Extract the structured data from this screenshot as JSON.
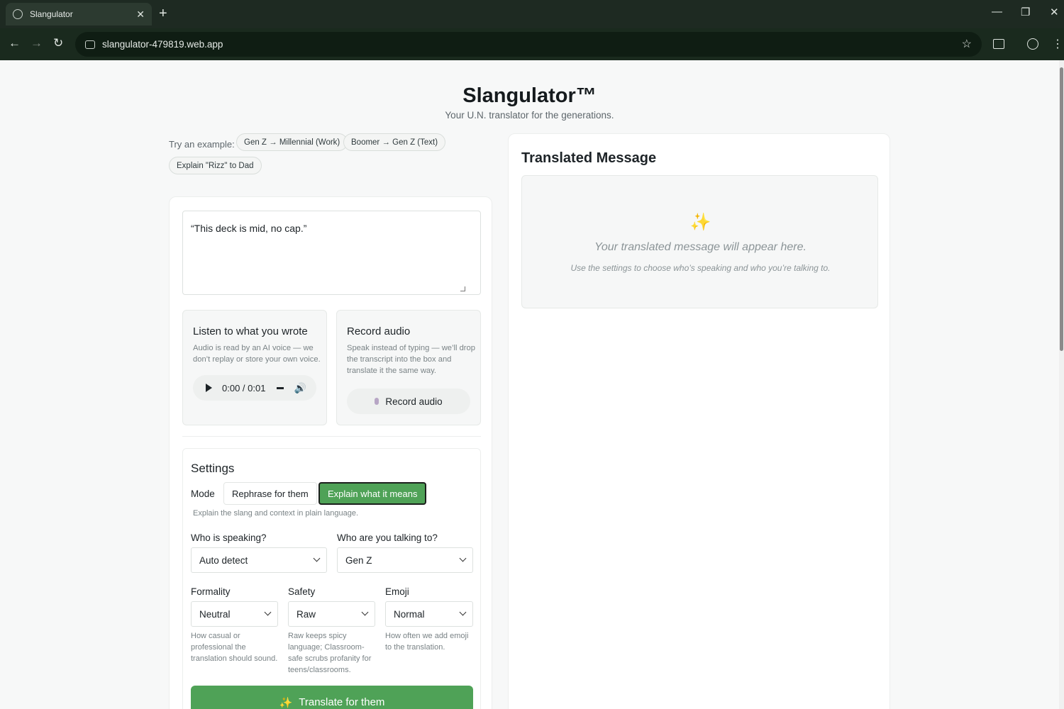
{
  "browser": {
    "tab_title": "Slangulator",
    "tab_close": "✕",
    "new_tab": "+",
    "url": "slangulator-479819.web.app",
    "back": "←",
    "forward": "→",
    "reload": "↻",
    "minimize": "—",
    "restore": "❐",
    "close": "✕",
    "star": "☆",
    "menu": "⋮"
  },
  "header": {
    "title": "Slangulator™",
    "subtitle": "Your U.N. translator for the generations."
  },
  "examples": {
    "label": "Try an example:",
    "chips": [
      "Gen Z → Millennial (Work)",
      "Boomer → Gen Z (Text)",
      "Explain \"Rizz\" to Dad"
    ]
  },
  "input": {
    "text": "“This deck is mid, no cap.”"
  },
  "listen": {
    "title": "Listen to what you wrote",
    "description": "Audio is read by an AI voice — we don’t replay or store your own voice.",
    "time": "0:00 / 0:01"
  },
  "record": {
    "title": "Record audio",
    "description": "Speak instead of typing — we’ll drop the transcript into the box and translate it the same way.",
    "button": "Record audio"
  },
  "settings": {
    "title": "Settings",
    "mode_label": "Mode",
    "mode_options": [
      "Rephrase for them",
      "Explain what it means"
    ],
    "mode_selected": "Explain what it means",
    "mode_help": "Explain the slang and context in plain language.",
    "speaker_label": "Who is speaking?",
    "speaker_value": "Auto detect",
    "audience_label": "Who are you talking to?",
    "audience_value": "Gen Z",
    "formality_label": "Formality",
    "formality_value": "Neutral",
    "formality_help": "How casual or professional the translation should sound.",
    "safety_label": "Safety",
    "safety_value": "Raw",
    "safety_help": "Raw keeps spicy language; Classroom-safe scrubs profanity for teens/classrooms.",
    "emoji_label": "Emoji",
    "emoji_value": "Normal",
    "emoji_help": "How often we add emoji to the translation.",
    "translate_button": "Translate for them",
    "translate_icon": "✨"
  },
  "output": {
    "title": "Translated Message",
    "icon": "✨",
    "placeholder": "Your translated message will appear here.",
    "placeholder_sub": "Use the settings to choose who’s speaking and who you’re talking to."
  },
  "colors": {
    "accent_green": "#4fa257",
    "chrome_dark": "#1e2a22"
  }
}
